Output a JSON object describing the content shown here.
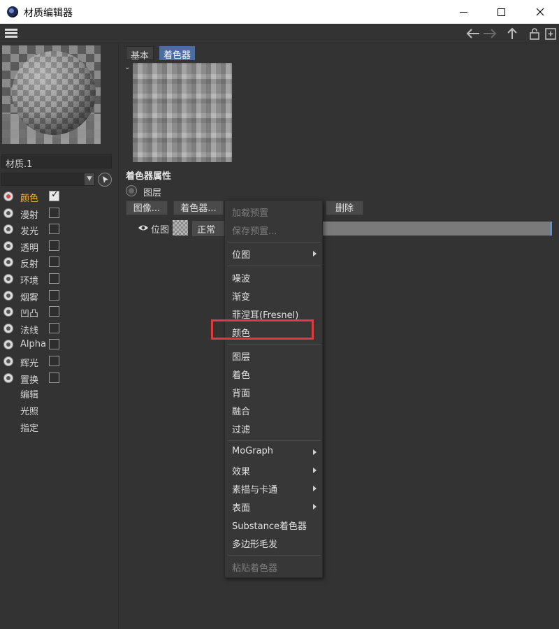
{
  "window": {
    "title": "材质编辑器"
  },
  "material": {
    "name": "材质.1"
  },
  "channels": [
    {
      "label": "颜色",
      "checked": true,
      "active": true
    },
    {
      "label": "漫射",
      "checked": false,
      "active": false
    },
    {
      "label": "发光",
      "checked": false,
      "active": false
    },
    {
      "label": "透明",
      "checked": false,
      "active": false
    },
    {
      "label": "反射",
      "checked": false,
      "active": false
    },
    {
      "label": "环境",
      "checked": false,
      "active": false
    },
    {
      "label": "烟雾",
      "checked": false,
      "active": false
    },
    {
      "label": "凹凸",
      "checked": false,
      "active": false
    },
    {
      "label": "法线",
      "checked": false,
      "active": false
    },
    {
      "label": "Alpha",
      "checked": false,
      "active": false
    },
    {
      "label": "辉光",
      "checked": false,
      "active": false
    },
    {
      "label": "置换",
      "checked": false,
      "active": false
    }
  ],
  "extra_items": [
    "编辑",
    "光照",
    "指定"
  ],
  "tabs": {
    "basic": "基本",
    "shader": "着色器"
  },
  "shader_props": {
    "title": "着色器属性",
    "layer_label": "图层",
    "image_button": "图像...",
    "shader_button": "着色器...",
    "delete_button": "删除",
    "bitmap_label": "位图",
    "blend_mode": "正常"
  },
  "context_menu": {
    "load_preset": "加载预置",
    "save_preset": "保存预置...",
    "bitmap": "位图",
    "noise": "噪波",
    "gradient": "渐变",
    "fresnel": "菲涅耳(Fresnel)",
    "color": "颜色",
    "layer": "图层",
    "colorize": "着色",
    "backface": "背面",
    "fusion": "融合",
    "filter": "过滤",
    "mograph": "MoGraph",
    "effects": "效果",
    "sketch_toon": "素描与卡通",
    "surfaces": "表面",
    "substance": "Substance着色器",
    "hair": "多边形毛发",
    "paste_shader": "粘贴着色器"
  },
  "colors": {
    "highlight": "#e03b3b",
    "active_tab": "#4b6d9f",
    "active_channel": "#f0b44a"
  }
}
